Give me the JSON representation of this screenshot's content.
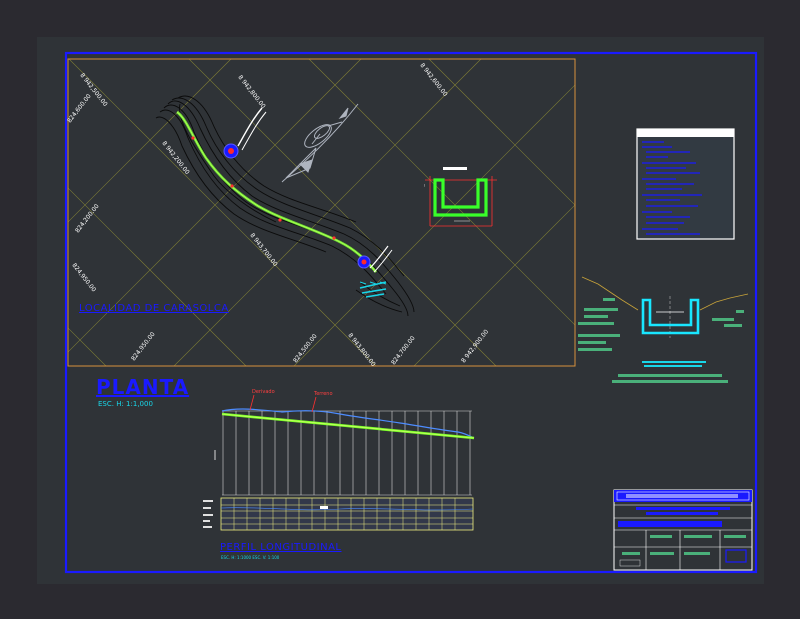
{
  "colors": {
    "background": "#2b2a30",
    "sheet": "#2e3436",
    "frame": "#1a1aff",
    "viewport": "#d7923c",
    "grid": "#8a8a3a",
    "canal": "#7cff2a",
    "contour": "#000000",
    "accent_cyan": "#19d6e8",
    "accent_red": "#ff2a2a",
    "table_green": "#4ab07a"
  },
  "plan": {
    "coordinates": {
      "top": [
        "8 942,800.00",
        "8 942,600.00",
        "8 942,500.00"
      ],
      "left": [
        "824,600.00",
        "824,200.00",
        "824,950.00"
      ],
      "middle": [
        "8 942,200.00",
        "8 943,700.00"
      ],
      "bottom": [
        "824,950.00",
        "824,500.00",
        "8 943,800.00",
        "824,700.00",
        "8 942,900.00"
      ]
    },
    "locality": "LOCALIDAD DE CARASOLCA"
  },
  "planta": {
    "title": "PLANTA",
    "scale": "ESC. H: 1:1,000"
  },
  "profile": {
    "markers": [
      "Derivado",
      "Terreno"
    ],
    "title": "PERFIL LONGITUDINAL",
    "scales": "ESC. H: 1:1000    ESC. V: 1:100"
  }
}
